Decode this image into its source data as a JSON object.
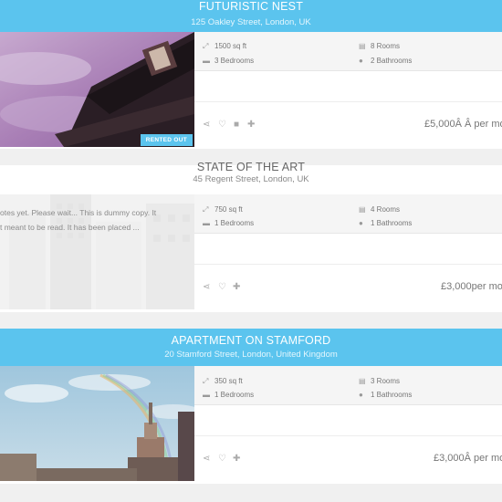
{
  "listings": [
    {
      "title": "FUTURISTIC NEST",
      "address": "125 Oakley Street, London, UK",
      "area": "1500 sq ft",
      "rooms": "8 Rooms",
      "bedrooms": "3 Bedrooms",
      "bathrooms": "2 Bathrooms",
      "price": "£5,000Â Â per mo",
      "badge": "RENTED OUT"
    },
    {
      "title": "STATE OF THE ART",
      "address": "45 Regent Street, London, UK",
      "area": "750 sq ft",
      "rooms": "4 Rooms",
      "bedrooms": "1 Bedrooms",
      "bathrooms": "1 Bathrooms",
      "price": "£3,000per mo",
      "excerpt_line1": "otes yet. Please wait... This is dummy copy. It",
      "excerpt_line2": "t meant to be read. It has been placed ..."
    },
    {
      "title": "APARTMENT ON STAMFORD",
      "address": "20 Stamford Street, London, United Kingdom",
      "area": "350 sq ft",
      "rooms": "3 Rooms",
      "bedrooms": "1 Bedrooms",
      "bathrooms": "1 Bathrooms",
      "price": "£3,000Â per mo"
    }
  ],
  "icons": {
    "area": "resize-icon",
    "rooms": "building-icon",
    "bedrooms": "bed-icon",
    "bathrooms": "drop-icon",
    "share": "share-icon",
    "favorite": "heart-icon",
    "video": "video-icon",
    "add": "plus-icon"
  },
  "colors": {
    "accent": "#5bc4ee"
  }
}
